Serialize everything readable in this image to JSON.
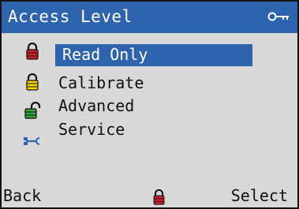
{
  "header": {
    "title": "Access Level",
    "key_icon": "key-icon"
  },
  "menu": {
    "items": [
      {
        "label": "Read Only",
        "icon": "lock-closed-red-icon",
        "selected": true
      },
      {
        "label": "Calibrate",
        "icon": "lock-closed-yellow-icon",
        "selected": false
      },
      {
        "label": "Advanced",
        "icon": "lock-open-green-icon",
        "selected": false
      },
      {
        "label": "Service",
        "icon": "wrench-icon",
        "selected": false
      }
    ]
  },
  "softkeys": {
    "left_label": "Back",
    "right_label": "Select",
    "center_icon": "lock-closed-red-icon"
  },
  "colors": {
    "titlebar": "#2e63ad",
    "selection": "#2e63ad",
    "background": "#d8d8d8",
    "lock_red": "#d21f2b",
    "lock_yellow": "#f2d300",
    "lock_green": "#36a338",
    "wrench_blue": "#2e63ad"
  }
}
